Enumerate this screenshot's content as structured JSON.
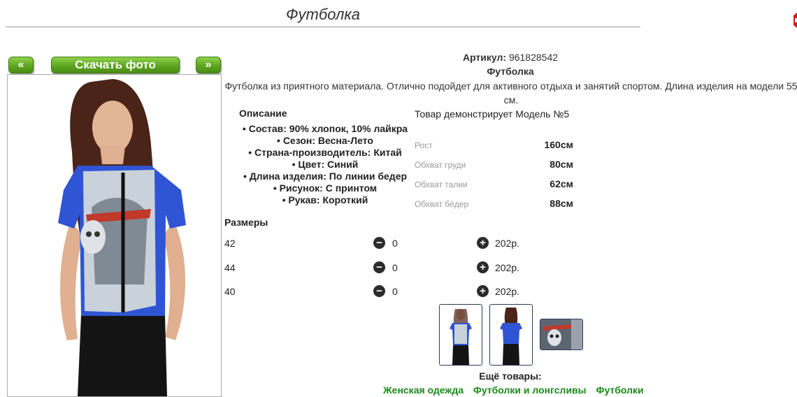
{
  "header": {
    "title": "Футболка"
  },
  "gallery": {
    "prev_label": "«",
    "download_label": "Скачать фото",
    "next_label": "»"
  },
  "product": {
    "artikul_label": "Артикул:",
    "artikul_value": "961828542",
    "name": "Футболка",
    "description": "Футболка из приятного материала. Отлично подойдет для активного отдыха и занятий спортом. Длина изделия на модели 55 см."
  },
  "details": {
    "heading": "Описание",
    "items": [
      "• Состав: 90% хлопок, 10% лайкра",
      "• Сезон: Весна-Лето",
      "• Страна-производитель: Китай",
      "• Цвет: Синий",
      "• Длина изделия: По линии бедер",
      "• Рисунок: С принтом",
      "• Рукав: Короткий"
    ]
  },
  "model": {
    "heading": "Товар демонстрирует Модель №5",
    "measurements": [
      {
        "label": "Рост",
        "value": "160см"
      },
      {
        "label": "Обхват груди",
        "value": "80см"
      },
      {
        "label": "Обхват талии",
        "value": "62см"
      },
      {
        "label": "Обхват бёдер",
        "value": "88см"
      }
    ]
  },
  "sizes": {
    "heading": "Размеры",
    "rows": [
      {
        "size": "42",
        "qty": "0",
        "price": "202р."
      },
      {
        "size": "44",
        "qty": "0",
        "price": "202р."
      },
      {
        "size": "40",
        "qty": "0",
        "price": "202р."
      }
    ]
  },
  "more": {
    "heading": "Ещё товары:",
    "links": [
      "Женская одежда",
      "Футболки и лонгсливы",
      "Футболки"
    ]
  },
  "colors": {
    "accent_green": "#5da620",
    "shirt_blue": "#2f55d4",
    "link_green": "#1b8a1b"
  }
}
